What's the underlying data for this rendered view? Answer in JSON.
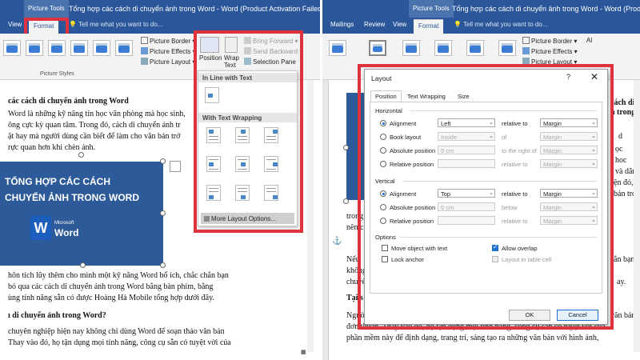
{
  "left": {
    "context": "Picture Tools",
    "title": "Tổng hợp các cách di chuyển ảnh trong Word - Word (Product Activation Failed)",
    "tabs": {
      "view": "View",
      "format": "Format"
    },
    "tell": "Tell me what you want to do...",
    "ribbon": {
      "border": "Picture Border",
      "effects": "Picture Effects",
      "layout": "Picture Layout",
      "position": "Position",
      "wrap": "Wrap",
      "wrap2": "Text",
      "bring": "Bring Forward",
      "send": "Send Backward",
      "selpane": "Selection Pane",
      "styles": "Picture Styles"
    },
    "doc": {
      "h1": "các cách di chuyển ảnh trong Word",
      "p1": [
        "Word là những kỹ năng tin học văn phòng mà học sinh,",
        "ông cực kỳ quan tâm. Trong đó, cách di chuyển ảnh tr",
        "ật hay mà người dùng cần biết để làm cho văn bản trở",
        "rực quan hơn khi chèn ảnh."
      ],
      "img1": "TỔNG HỢP CÁC CÁCH",
      "img2": "CHUYỂN ẢNH TRONG WORD",
      "ms": "Microsoft",
      "word": "Word",
      "w": "W",
      "p2": [
        "hôn tích lũy thêm cho mình một kỹ năng Word bổ ích, chắc chắn bạn",
        "bỏ qua các cách di chuyển ảnh trong Word bằng bàn phím, bằng",
        "ùng tính năng sẵn có được Hoàng Hà Mobile tổng hợp dưới đây."
      ],
      "h2": "ı di chuyển ảnh trong Word?",
      "p3": [
        "chuyên nghiệp hiện nay không chỉ dùng Word để soạn thảo văn bản",
        "Thay vào đó, họ tận dụng mọi tính năng, công cụ sẵn có tuyệt vời của"
      ]
    },
    "dropdown": {
      "inline": "In Line with Text",
      "wrapping": "With Text Wrapping",
      "more": "More Layout Options..."
    }
  },
  "right": {
    "context": "Picture Tools",
    "title": "Tổng hợp các cách di chuyển ảnh trong Word - Word (Product Activati",
    "tabs": {
      "mailings": "Mailings",
      "review": "Review",
      "view": "View",
      "format": "Format"
    },
    "tell": "Tell me what you want to do...",
    "ribbon": {
      "border": "Picture Border",
      "effects": "Picture Effects",
      "layout": "Picture Layout",
      "al": "Al"
    },
    "doc": {
      "frag": [
        "cách di",
        "h trong",
        "d",
        "ọc",
        "hoc",
        "và dân",
        "ện đó,",
        "bản trở"
      ],
      "tron": "trong",
      "nen": "nên c",
      "nev": "Nếu",
      "khon": "không",
      "chuy": "chuyể",
      "pre": "ắn bạn",
      "ay": "ay.",
      "tai": "Tại s",
      "ngu": "Người",
      "don": "đơn thuần. Thay vào đó, họ tận dụng mọi tính năng, công cụ sẵn có tuyệt vời của",
      "ph": "phần mềm này để định dạng, trang trí, sáng tạo ra những văn bản với hình ảnh,",
      "cl": "văn bản",
      "min": "minh họa"
    }
  },
  "dialog": {
    "title": "Layout",
    "help": "?",
    "close": "✕",
    "tabs": [
      "Position",
      "Text Wrapping",
      "Size"
    ],
    "horizontal": "Horizontal",
    "vertical": "Vertical",
    "options": "Options",
    "h_rows": [
      {
        "label": "Alignment",
        "value": "Left",
        "rel": "relative to",
        "relv": "Margin"
      },
      {
        "label": "Book layout",
        "value": "Inside",
        "rel": "of",
        "relv": "Margin"
      },
      {
        "label": "Absolute position",
        "value": "0 cm",
        "rel": "to the right of",
        "relv": "Margin"
      },
      {
        "label": "Relative position",
        "value": "",
        "rel": "relative to",
        "relv": "Margin"
      }
    ],
    "v_rows": [
      {
        "label": "Alignment",
        "value": "Top",
        "rel": "relative to",
        "relv": "Margin"
      },
      {
        "label": "Absolute position",
        "value": "0 cm",
        "rel": "below",
        "relv": "Margin"
      },
      {
        "label": "Relative position",
        "value": "",
        "rel": "relative to",
        "relv": "Margin"
      }
    ],
    "opt": {
      "move": "Move object with text",
      "lock": "Lock anchor",
      "overlap": "Allow overlap",
      "table": "Layout in table cell"
    },
    "ok": "OK",
    "cancel": "Cancel"
  },
  "colors": {
    "accent": "#2b579a",
    "highlight": "#e0323c"
  }
}
